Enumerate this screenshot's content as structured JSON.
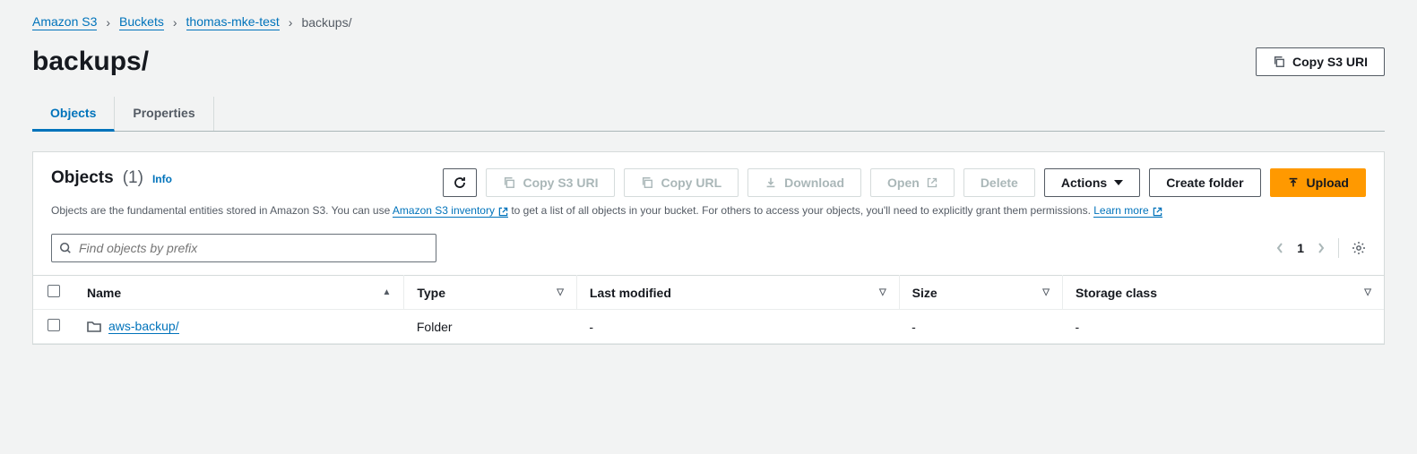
{
  "breadcrumb": {
    "items": [
      {
        "label": "Amazon S3"
      },
      {
        "label": "Buckets"
      },
      {
        "label": "thomas-mke-test"
      }
    ],
    "current": "backups/"
  },
  "header": {
    "title": "backups/",
    "copy_uri_label": "Copy S3 URI"
  },
  "tabs": {
    "objects": "Objects",
    "properties": "Properties"
  },
  "panel": {
    "title": "Objects",
    "count": "(1)",
    "info_label": "Info",
    "desc_1": "Objects are the fundamental entities stored in Amazon S3. You can use ",
    "desc_link1": "Amazon S3 inventory",
    "desc_2": " to get a list of all objects in your bucket. For others to access your objects, you'll need to explicitly grant them permissions. ",
    "desc_link2": "Learn more"
  },
  "actions": {
    "copy_uri": "Copy S3 URI",
    "copy_url": "Copy URL",
    "download": "Download",
    "open": "Open",
    "delete": "Delete",
    "actions": "Actions",
    "create_folder": "Create folder",
    "upload": "Upload"
  },
  "search": {
    "placeholder": "Find objects by prefix"
  },
  "pagination": {
    "page": "1"
  },
  "table": {
    "columns": {
      "name": "Name",
      "type": "Type",
      "last_modified": "Last modified",
      "size": "Size",
      "storage_class": "Storage class"
    },
    "rows": [
      {
        "name": "aws-backup/",
        "type": "Folder",
        "last_modified": "-",
        "size": "-",
        "storage_class": "-"
      }
    ]
  }
}
